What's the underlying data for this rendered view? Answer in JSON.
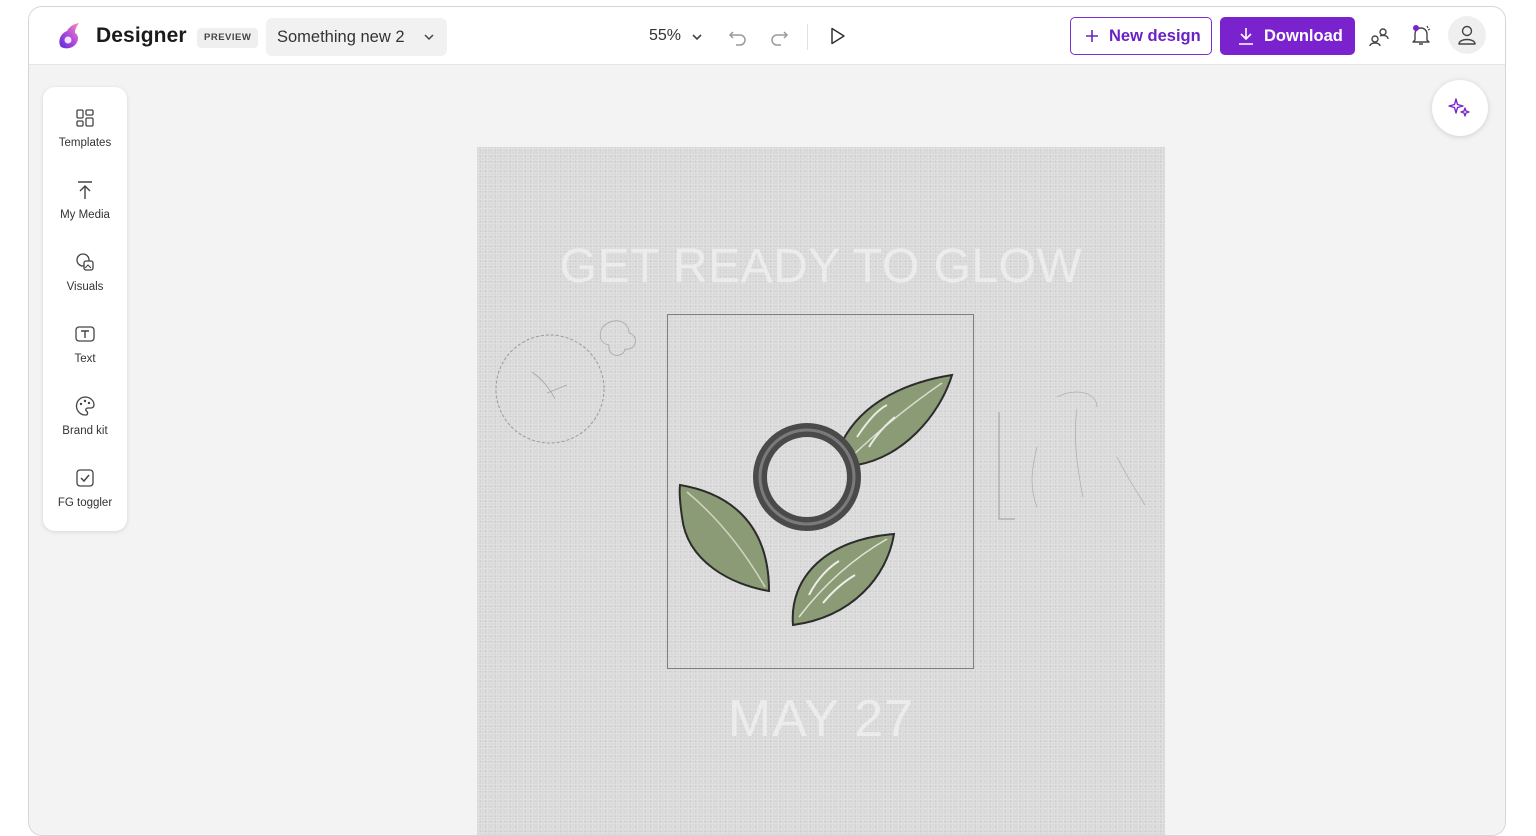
{
  "app": {
    "name": "Designer",
    "badge": "PREVIEW",
    "document_name": "Something new 2",
    "brand_color": "#7b22cf"
  },
  "toolbar": {
    "zoom": "55%",
    "new_design_label": "New design",
    "download_label": "Download",
    "icons": [
      "undo-icon",
      "redo-icon",
      "play-icon",
      "share-icon",
      "notifications-icon",
      "account-icon"
    ]
  },
  "sidebar": {
    "items": [
      {
        "label": "Templates",
        "icon": "templates-icon"
      },
      {
        "label": "My Media",
        "icon": "upload-icon"
      },
      {
        "label": "Visuals",
        "icon": "visuals-icon"
      },
      {
        "label": "Text",
        "icon": "text-icon"
      },
      {
        "label": "Brand kit",
        "icon": "palette-icon"
      },
      {
        "label": "FG toggler",
        "icon": "checkbox-icon"
      }
    ]
  },
  "canvas": {
    "headline": "GET READY TO GLOW",
    "date": "MAY 27"
  }
}
